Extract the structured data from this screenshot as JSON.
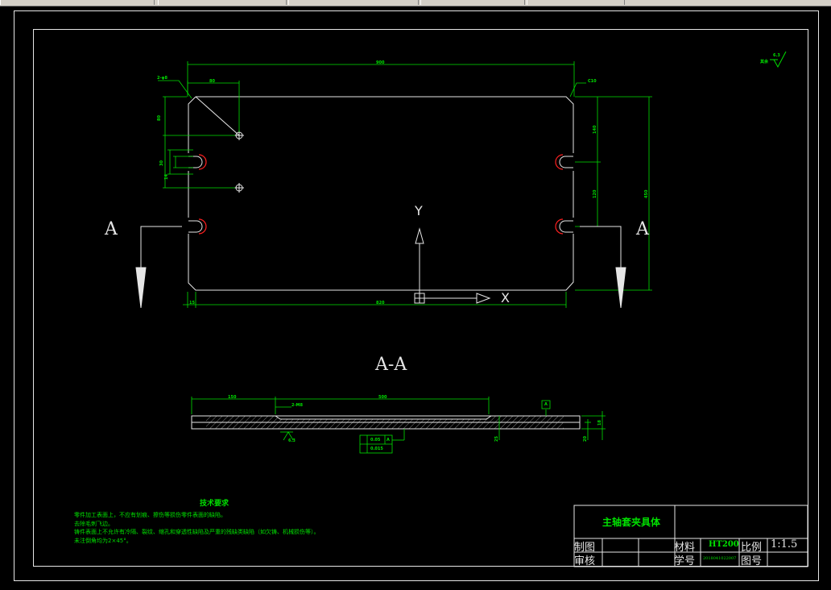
{
  "section_label": "A",
  "section_title": "A-A",
  "axis": {
    "y": "Y",
    "x": "X"
  },
  "dims": {
    "top_width": "900",
    "offset_x": "80",
    "chamfer_tl": "2-φ8",
    "chamfer_tr": "C10",
    "left_v1": "80",
    "left_v2": "30",
    "left_v3": "14",
    "right_v1": "140",
    "right_v2": "120",
    "right_total": "450",
    "bottom_left": "15",
    "bottom_width": "820",
    "sec_left": "150",
    "sec_mid": "500",
    "sec_hole": "2-M8",
    "sec_h1": "18",
    "sec_h2": "20",
    "sec_h3": "25"
  },
  "roughness": {
    "corner": "其余",
    "corner_val": "6.3",
    "surface": "6.3"
  },
  "tolerance": {
    "row1": "0.05",
    "row1_ref": "A",
    "row2": "0.015",
    "datum": "A"
  },
  "tech": {
    "title": "技术要求",
    "lines": [
      "零件加工表面上，不应有划痕、擦伤等损伤零件表面的缺陷。",
      "去除毛刺飞边。",
      "铸件表面上不允许有冷隔、裂纹、缩孔和穿透性缺陷及严重的残缺类缺陷（如欠铸、机械损伤等）。",
      "未注倒角均为2×45°。"
    ]
  },
  "title_block": {
    "name": "主轴套夹具体",
    "drawn": "制图",
    "checked": "审核",
    "material_label": "材料",
    "material": "HT200",
    "scale_label": "比例",
    "scale": "1:1.5",
    "student_label": "学号",
    "student_no": "2018041022007",
    "drawing_no_label": "图号"
  }
}
